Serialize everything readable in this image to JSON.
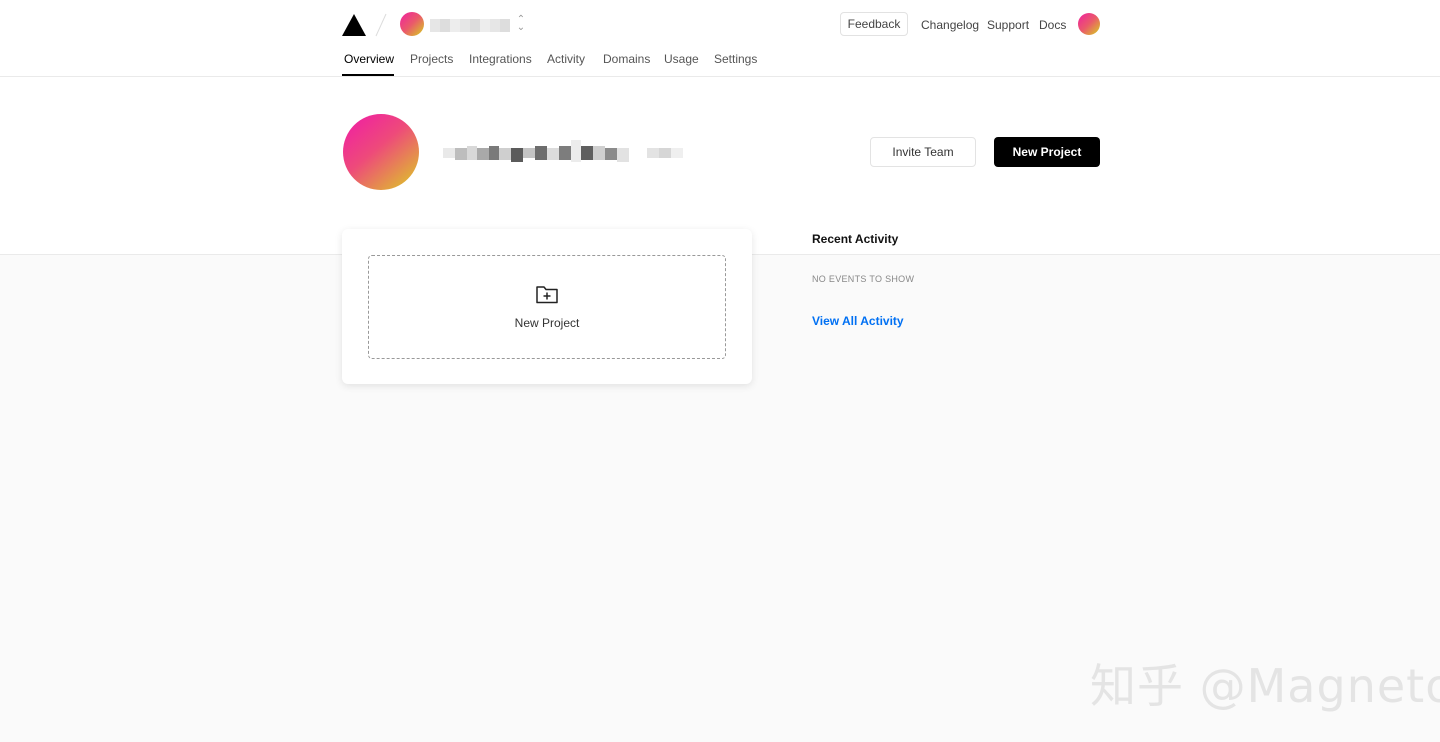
{
  "header": {
    "feedback_label": "Feedback",
    "links": [
      "Changelog",
      "Support",
      "Docs"
    ]
  },
  "tabs": [
    "Overview",
    "Projects",
    "Integrations",
    "Activity",
    "Domains",
    "Usage",
    "Settings"
  ],
  "active_tab": "Overview",
  "hero": {
    "invite_label": "Invite Team",
    "new_project_label": "New Project"
  },
  "projects_card": {
    "new_project_label": "New Project"
  },
  "activity": {
    "title": "Recent Activity",
    "empty_text": "NO EVENTS TO SHOW",
    "view_all_label": "View All Activity"
  },
  "watermark": "知乎 @Magneto",
  "colors": {
    "accent_link": "#0070f3",
    "primary_button": "#000000",
    "avatar_gradient": [
      "#f020a0",
      "#ea5a6a",
      "#d6d21e"
    ]
  }
}
